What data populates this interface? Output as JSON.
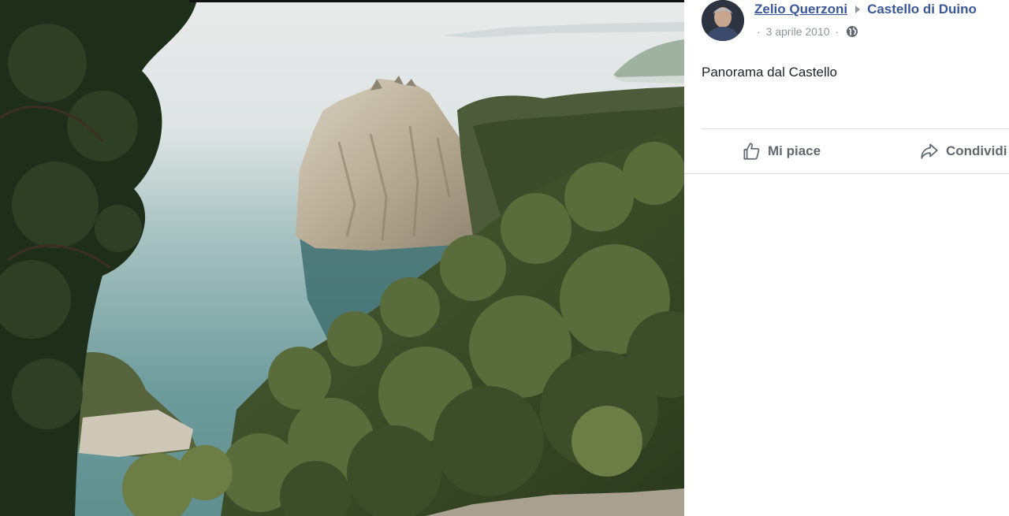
{
  "post": {
    "author": "Zelio Querzoni",
    "place": "Castello di Duino",
    "date": "3 aprile 2010",
    "separator": "·",
    "caption": "Panorama dal Castello",
    "privacy_icon": "globe-icon"
  },
  "actions": {
    "like_label": "Mi piace",
    "like_icon": "thumbs-up-icon",
    "share_label": "Condividi",
    "share_icon": "share-arrow-icon"
  },
  "colors": {
    "link": "#385898",
    "meta": "#90949c",
    "text": "#1d2129",
    "action": "#606770",
    "divider": "#dadde1"
  }
}
